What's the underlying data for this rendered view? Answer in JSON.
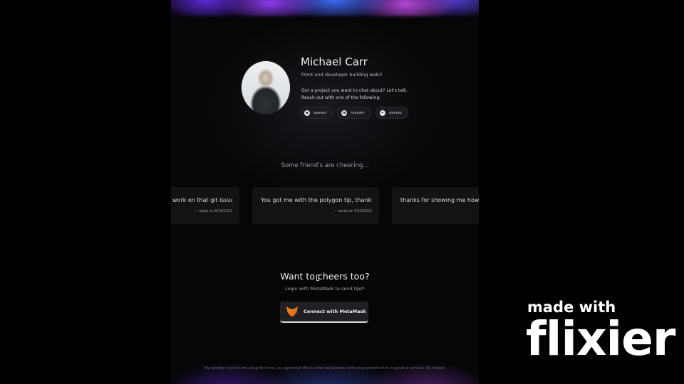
{
  "profile": {
    "name": "Michael Carr",
    "tagline": "Front end developer building web3",
    "pitch_line1": "Got a project you want to chat about? Let's talk.",
    "pitch_line2": "Reach out with one of the following:",
    "socials": [
      {
        "icon": "github-icon",
        "glyph": "◉",
        "handle": "xyeres"
      },
      {
        "icon": "linkedin-icon",
        "glyph": "in",
        "handle": "mxcarr"
      },
      {
        "icon": "twitter-icon",
        "glyph": "✦",
        "handle": "xyeres"
      }
    ]
  },
  "cheers": {
    "title": "Some friend's are cheering...",
    "cards": [
      {
        "message": "work on that git issue",
        "byline": "— moby on 9/19/2022"
      },
      {
        "message": "You got me with the polygon tip, thanks",
        "byline": "— sarah on 9/19/2022"
      },
      {
        "message": "thanks for showing me how",
        "byline": ""
      }
    ]
  },
  "cta": {
    "heading": "Want to cheers too?",
    "hint": "Login with MetaMask to send tips*",
    "button_label": "Connect with MetaMask"
  },
  "footer": {
    "disclaimer": "*By sending crypto to me using this form, you agree that this is a free-will donation with no promised return in goods or services. No refunds."
  },
  "watermark": {
    "line1": "made with",
    "line2": "flixier"
  },
  "colors": {
    "background": "#000000",
    "accent_purple": "#8a3bea",
    "metamask_orange": "#f6851b"
  }
}
